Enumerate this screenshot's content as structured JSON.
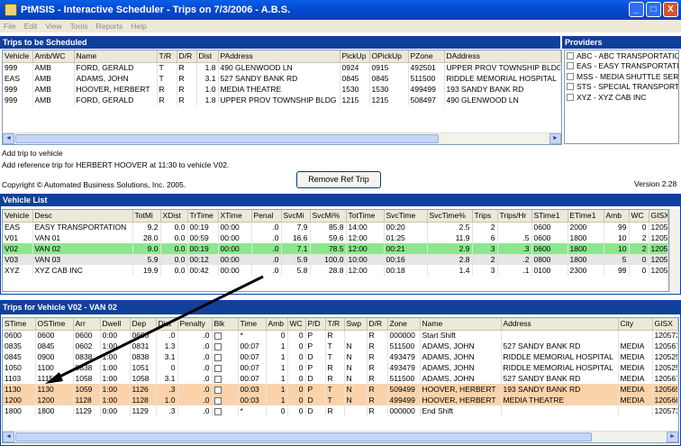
{
  "window": {
    "title": "PtMSIS - Interactive Scheduler - Trips on 7/3/2006 - A.B.S.",
    "min": "_",
    "max": "□",
    "close": "X"
  },
  "menu": [
    "File",
    "Edit",
    "View",
    "Tools",
    "Reports",
    "Help"
  ],
  "trips_section": {
    "title": "Trips to be Scheduled",
    "columns": [
      "Vehicle",
      "Amb/WC",
      "Name",
      "T/R",
      "D/R",
      "Dist",
      "PAddress",
      "PickUp",
      "OPickUp",
      "PZone",
      "DAddress"
    ],
    "rows": [
      [
        "999",
        "AMB",
        "FORD, GERALD",
        "T",
        "R",
        "1.8",
        "490 GLENWOOD LN",
        "0924",
        "0915",
        "492501",
        "UPPER PROV TOWNSHIP BLDG"
      ],
      [
        "EAS",
        "AMB",
        "ADAMS, JOHN",
        "T",
        "R",
        "3.1",
        "527 SANDY BANK RD",
        "0845",
        "0845",
        "511500",
        "RIDDLE MEMORIAL HOSPITAL"
      ],
      [
        "999",
        "AMB",
        "HOOVER, HERBERT",
        "R",
        "R",
        "1.0",
        "MEDIA THEATRE",
        "1530",
        "1530",
        "499499",
        "193 SANDY BANK RD"
      ],
      [
        "999",
        "AMB",
        "FORD, GERALD",
        "R",
        "R",
        "1.8",
        "UPPER PROV TOWNSHIP BLDG",
        "1215",
        "1215",
        "508497",
        "490 GLENWOOD LN"
      ]
    ]
  },
  "providers": {
    "title": "Providers",
    "items": [
      "ABC - ABC TRANSPORTATION",
      "EAS - EASY TRANSPORTATION",
      "MSS - MEDIA SHUTTLE SERVICE",
      "STS - SPECIAL TRANSPORT",
      "XYZ - XYZ CAB INC"
    ]
  },
  "messages": {
    "line1": "Add trip to vehicle",
    "line2": "Add reference trip for HERBERT HOOVER at 11:30 to vehicle V02.",
    "copyright": "Copyright © Automated Business Solutions, Inc. 2005.",
    "version": "Version 2.28"
  },
  "remove_button": "Remove Ref Trip",
  "vehicle_section": {
    "title": "Vehicle List",
    "columns": [
      "Vehicle",
      "Desc",
      "TotMi",
      "XDist",
      "TrTime",
      "XTime",
      "Penal",
      "SvcMi",
      "SvcMi%",
      "TotTime",
      "SvcTime",
      "SvcTime%",
      "Trips",
      "Trips/Hr",
      "STime1",
      "ETime1",
      "Amb",
      "WC",
      "GISX"
    ],
    "rows": [
      [
        "EAS",
        "EASY TRANSPORTATION",
        "9.2",
        "0.0",
        "00:19",
        "00:00",
        ".0",
        "7.9",
        "85.8",
        "14:00",
        "00:20",
        "2.5",
        "2",
        "",
        "0600",
        "2000",
        "99",
        "0",
        "12057362"
      ],
      [
        "V01",
        "VAN 01",
        "28.0",
        "0.0",
        "00:59",
        "00:00",
        ".0",
        "16.6",
        "59.6",
        "12:00",
        "01:25",
        "11.9",
        "6",
        ".5",
        "0600",
        "1800",
        "10",
        "2",
        "12057362"
      ],
      [
        "V02",
        "VAN 02",
        "9.0",
        "0.0",
        "00:19",
        "00:00",
        ".0",
        "7.1",
        "78.5",
        "12:00",
        "00:21",
        "2.9",
        "3",
        ".3",
        "0600",
        "1800",
        "10",
        "2",
        "12057362"
      ],
      [
        "V03",
        "VAN 03",
        "5.9",
        "0.0",
        "00:12",
        "00:00",
        ".0",
        "5.9",
        "100.0",
        "10:00",
        "00:16",
        "2.8",
        "2",
        ".2",
        "0800",
        "1800",
        "5",
        "0",
        "12057362"
      ],
      [
        "XYZ",
        "XYZ CAB INC",
        "19.9",
        "0.0",
        "00:42",
        "00:00",
        ".0",
        "5.8",
        "28.8",
        "12:00",
        "00:18",
        "1.4",
        "3",
        ".1",
        "0100",
        "2300",
        "99",
        "0",
        "12057362"
      ]
    ]
  },
  "trips_vehicle_section": {
    "title": "Trips for Vehicle V02 - VAN 02",
    "columns": [
      "STime",
      "OSTime",
      "Arr",
      "Dwell",
      "Dep",
      "Dist",
      "Penalty",
      "Blk",
      "Time",
      "Amb",
      "WC",
      "P/D",
      "T/R",
      "Swp",
      "D/R",
      "Zone",
      "Name",
      "Address",
      "City",
      "GISX"
    ],
    "rows": [
      [
        "0600",
        "0600",
        "0600",
        "0:00",
        "0600",
        ".0",
        ".0",
        "",
        "*",
        "0",
        "0",
        "P",
        "R",
        "",
        "R",
        "000000",
        "Start Shift",
        "",
        "",
        "12057362"
      ],
      [
        "0835",
        "0845",
        "0602",
        "1:00",
        "0831",
        "1.3",
        ".0",
        "",
        "00:07",
        "1",
        "0",
        "P",
        "T",
        "N",
        "R",
        "511500",
        "ADAMS, JOHN",
        "527 SANDY BANK RD",
        "MEDIA",
        "12056757"
      ],
      [
        "0845",
        "0900",
        "0838",
        "1:00",
        "0838",
        "3.1",
        ".0",
        "",
        "00:07",
        "1",
        "0",
        "D",
        "T",
        "N",
        "R",
        "493479",
        "ADAMS, JOHN",
        "RIDDLE MEMORIAL HOSPITAL",
        "MEDIA",
        "12052522"
      ],
      [
        "1050",
        "1100",
        "0838",
        "1:00",
        "1051",
        "0",
        ".0",
        "",
        "00:07",
        "1",
        "0",
        "P",
        "R",
        "N",
        "R",
        "493479",
        "ADAMS, JOHN",
        "RIDDLE MEMORIAL HOSPITAL",
        "MEDIA",
        "12052522"
      ],
      [
        "1103",
        "1115",
        "1058",
        "1:00",
        "1058",
        "3.1",
        ".0",
        "",
        "00:07",
        "1",
        "0",
        "D",
        "R",
        "N",
        "R",
        "511500",
        "ADAMS, JOHN",
        "527 SANDY BANK RD",
        "MEDIA",
        "12056757"
      ],
      [
        "1130",
        "1130",
        "1059",
        "1:00",
        "1126",
        ".3",
        ".0",
        "",
        "00:03",
        "1",
        "0",
        "P",
        "T",
        "N",
        "R",
        "509499",
        "HOOVER, HERBERT",
        "193 SANDY BANK RD",
        "MEDIA",
        "12056552"
      ],
      [
        "1200",
        "1200",
        "1128",
        "1:00",
        "1128",
        "1.0",
        ".0",
        "",
        "00:03",
        "1",
        "0",
        "D",
        "T",
        "N",
        "R",
        "499499",
        "HOOVER, HERBERT",
        "MEDIA THEATRE",
        "MEDIA",
        "12056887"
      ],
      [
        "1800",
        "1800",
        "1129",
        "0:00",
        "1129",
        ".3",
        ".0",
        "",
        "*",
        "0",
        "0",
        "D",
        "R",
        "",
        "R",
        "000000",
        "End Shift",
        "",
        "",
        "12057362"
      ]
    ]
  },
  "scroll": {
    "left": "◄",
    "right": "►"
  }
}
